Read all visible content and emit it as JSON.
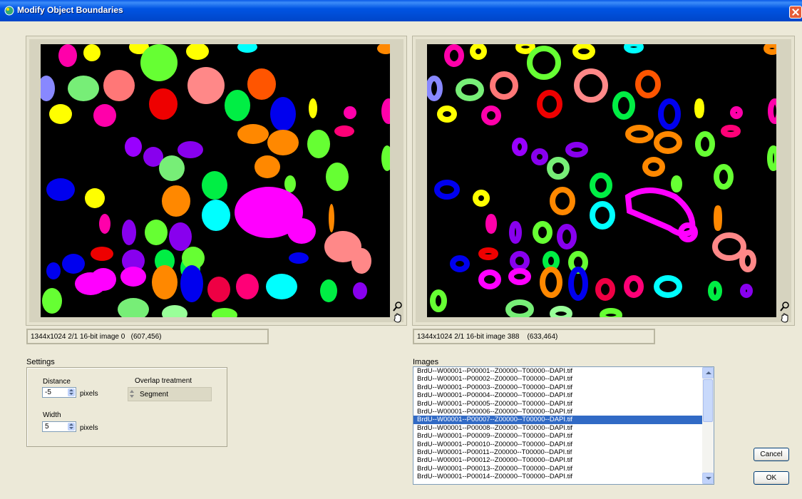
{
  "window": {
    "title": "Modify Object Boundaries",
    "icon": "app-icon"
  },
  "left_view": {
    "status": "1344x1024 2/1 16-bit image 0   (607,456)"
  },
  "right_view": {
    "status": "1344x1024 2/1 16-bit image 388    (633,464)"
  },
  "settings": {
    "group_label": "Settings",
    "distance_label": "Distance",
    "distance_value": "-5",
    "distance_units": "pixels",
    "width_label": "Width",
    "width_value": "5",
    "width_units": "pixels",
    "overlap_label": "Overlap treatment",
    "overlap_value": "Segment"
  },
  "images": {
    "label": "Images",
    "items": [
      "BrdU--W00001--P00001--Z00000--T00000--DAPI.tif",
      "BrdU--W00001--P00002--Z00000--T00000--DAPI.tif",
      "BrdU--W00001--P00003--Z00000--T00000--DAPI.tif",
      "BrdU--W00001--P00004--Z00000--T00000--DAPI.tif",
      "BrdU--W00001--P00005--Z00000--T00000--DAPI.tif",
      "BrdU--W00001--P00006--Z00000--T00000--DAPI.tif",
      "BrdU--W00001--P00007--Z00000--T00000--DAPI.tif",
      "BrdU--W00001--P00008--Z00000--T00000--DAPI.tif",
      "BrdU--W00001--P00009--Z00000--T00000--DAPI.tif",
      "BrdU--W00001--P00010--Z00000--T00000--DAPI.tif",
      "BrdU--W00001--P00011--Z00000--T00000--DAPI.tif",
      "BrdU--W00001--P00012--Z00000--T00000--DAPI.tif",
      "BrdU--W00001--P00013--Z00000--T00000--DAPI.tif",
      "BrdU--W00001--P00014--Z00000--T00000--DAPI.tif"
    ],
    "selected_index": 6
  },
  "buttons": {
    "cancel": "Cancel",
    "ok": "OK"
  },
  "colors": {
    "selection": "#316ac5",
    "titlebar": "#0054e3",
    "dialog_bg": "#ece9d8"
  }
}
